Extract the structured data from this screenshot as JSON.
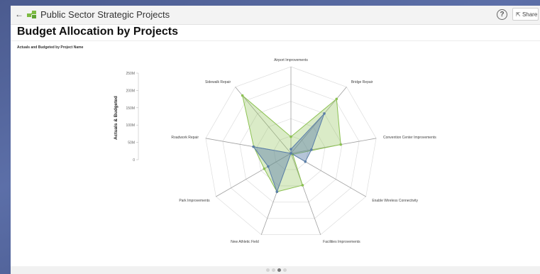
{
  "header": {
    "title": "Public Sector Strategic Projects",
    "share_label": "Share"
  },
  "page": {
    "title": "Budget Allocation by Projects",
    "subtitle": "Actuals and Budgeted by Project Name"
  },
  "pagination": {
    "count": 4,
    "active_index": 2
  },
  "colors": {
    "budgeted": "#8cc152",
    "actuals": "#5b7fa8",
    "grid": "#dddddd",
    "axis": "#a0a0a0"
  },
  "chart_data": {
    "type": "radar",
    "title": "",
    "ylabel": "Actuals & Budgeted",
    "ylim": [
      0,
      250
    ],
    "y_ticks": [
      "0",
      "50M",
      "100M",
      "150M",
      "200M",
      "250M"
    ],
    "y_units": "M",
    "categories": [
      "Airport Improvements",
      "Bridge Repair",
      "Convention Center Improvements",
      "Enable Wireless Connectivity",
      "Facilities Improvements",
      "New Athletic Field",
      "Park Improvements",
      "Roadwork Repair",
      "Sidewalk Repair"
    ],
    "series": [
      {
        "values": [
          48,
          205,
          146,
          6,
          98,
          118,
          89,
          109,
          218
        ]
      },
      {
        "values": [
          12,
          150,
          60,
          48,
          0,
          118,
          76,
          110,
          0
        ]
      }
    ]
  }
}
